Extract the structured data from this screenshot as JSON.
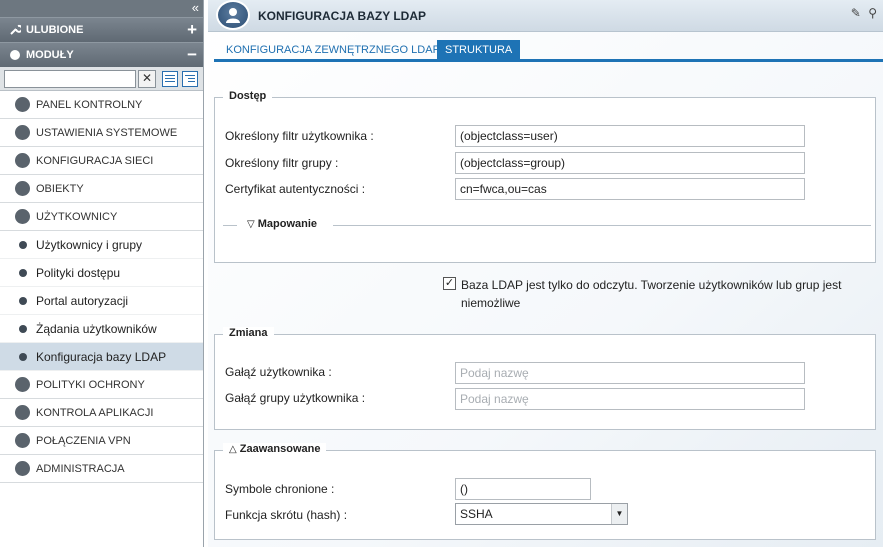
{
  "sidebar": {
    "favorites_label": "ULUBIONE",
    "modules_label": "MODUŁY",
    "search": {
      "value": "",
      "placeholder": ""
    },
    "items_top": [
      {
        "label": "PANEL KONTROLNY",
        "icon": "dashboard-icon"
      },
      {
        "label": "USTAWIENIA SYSTEMOWE",
        "icon": "settings-icon"
      },
      {
        "label": "KONFIGURACJA SIECI",
        "icon": "network-icon"
      },
      {
        "label": "OBIEKTY",
        "icon": "objects-icon"
      },
      {
        "label": "UŻYTKOWNICY",
        "icon": "users-icon"
      }
    ],
    "sub_items": [
      {
        "label": "Użytkownicy i grupy"
      },
      {
        "label": "Polityki dostępu"
      },
      {
        "label": "Portal autoryzacji"
      },
      {
        "label": "Żądania użytkowników"
      },
      {
        "label": "Konfiguracja bazy LDAP",
        "active": true
      }
    ],
    "items_bottom": [
      {
        "label": "POLITYKI OCHRONY",
        "icon": "policy-icon"
      },
      {
        "label": "KONTROLA APLIKACJI",
        "icon": "shield-icon"
      },
      {
        "label": "POŁĄCZENIA VPN",
        "icon": "vpn-icon"
      },
      {
        "label": "ADMINISTRACJA",
        "icon": "admin-icon"
      }
    ]
  },
  "header": {
    "title": "KONFIGURACJA BAZY LDAP"
  },
  "tabs": [
    {
      "label": "KONFIGURACJA ZEWNĘTRZNEGO LDAP",
      "active": false
    },
    {
      "label": "STRUKTURA",
      "active": true
    }
  ],
  "access": {
    "legend": "Dostęp",
    "user_filter_label": "Określony filtr użytkownika :",
    "user_filter_value": "(objectclass=user)",
    "group_filter_label": "Określony filtr grupy :",
    "group_filter_value": "(objectclass=group)",
    "cert_label": "Certyfikat autentyczności :",
    "cert_value": "cn=fwca,ou=cas",
    "mapping_label": "Mapowanie"
  },
  "readonly": {
    "checked": true,
    "text": "Baza LDAP jest tylko do odczytu. Tworzenie użytkowników lub grup jest niemożliwe"
  },
  "change": {
    "legend": "Zmiana",
    "user_branch_label": "Gałąź użytkownika :",
    "user_branch_placeholder": "Podaj nazwę",
    "group_branch_label": "Gałąź grupy użytkownika :",
    "group_branch_placeholder": "Podaj nazwę"
  },
  "advanced": {
    "legend": "Zaawansowane",
    "protected_label": "Symbole chronione :",
    "protected_value": "()",
    "hash_label": "Funkcja skrótu (hash) :",
    "hash_value": "SSHA"
  },
  "colors": {
    "accent": "#1e73b5",
    "sidebar_header": "#6d7780",
    "active_item": "#cfdbe6"
  }
}
